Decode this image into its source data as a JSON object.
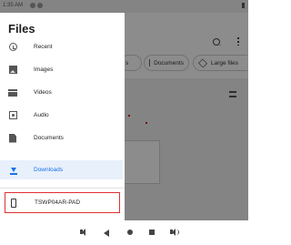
{
  "status_bar": {
    "time": "1:35 AM"
  },
  "drawer": {
    "title": "Files",
    "items": [
      {
        "label": "Recent",
        "icon": "recent-icon"
      },
      {
        "label": "Images",
        "icon": "images-icon"
      },
      {
        "label": "Videos",
        "icon": "videos-icon"
      },
      {
        "label": "Audio",
        "icon": "audio-icon"
      },
      {
        "label": "Documents",
        "icon": "documents-icon"
      },
      {
        "label": "Downloads",
        "icon": "download-icon",
        "active": true
      }
    ],
    "device": {
      "label": "TSWP04AR-PAD",
      "icon": "tablet-icon"
    }
  },
  "background": {
    "chips": [
      "s",
      "Documents",
      "Large files"
    ]
  },
  "colors": {
    "accent": "#1a73e8",
    "highlight_border": "#e03030",
    "scrim": "#000000"
  }
}
